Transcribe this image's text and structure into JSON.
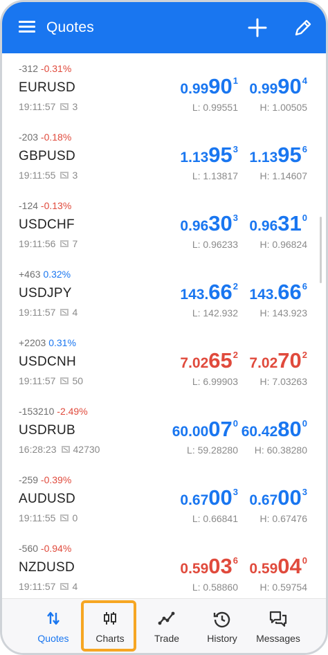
{
  "header": {
    "title": "Quotes",
    "menu_icon": "hamburger-icon",
    "add_icon": "plus-icon",
    "edit_icon": "pencil-icon",
    "color": "#1976f0"
  },
  "quotes": [
    {
      "change_pts": "-312",
      "change_pct": "-0.31%",
      "symbol": "EURUSD",
      "time": "19:11:57",
      "spread": "3",
      "bid": {
        "small": "0.99",
        "big": "90",
        "sup": "1"
      },
      "ask": {
        "small": "0.99",
        "big": "90",
        "sup": "4"
      },
      "low": "L: 0.99551",
      "high": "H: 1.00505"
    },
    {
      "change_pts": "-203",
      "change_pct": "-0.18%",
      "symbol": "GBPUSD",
      "time": "19:11:55",
      "spread": "3",
      "bid": {
        "small": "1.13",
        "big": "95",
        "sup": "3"
      },
      "ask": {
        "small": "1.13",
        "big": "95",
        "sup": "6"
      },
      "low": "L: 1.13817",
      "high": "H: 1.14607"
    },
    {
      "change_pts": "-124",
      "change_pct": "-0.13%",
      "symbol": "USDCHF",
      "time": "19:11:56",
      "spread": "7",
      "bid": {
        "small": "0.96",
        "big": "30",
        "sup": "3"
      },
      "ask": {
        "small": "0.96",
        "big": "31",
        "sup": "0"
      },
      "low": "L: 0.96233",
      "high": "H: 0.96824"
    },
    {
      "change_pts": "+463",
      "change_pct": "0.32%",
      "symbol": "USDJPY",
      "time": "19:11:57",
      "spread": "4",
      "bid": {
        "small": "143.",
        "big": "66",
        "sup": "2"
      },
      "ask": {
        "small": "143.",
        "big": "66",
        "sup": "6"
      },
      "low": "L: 142.932",
      "high": "H: 143.923"
    },
    {
      "change_pts": "+2203",
      "change_pct": "0.31%",
      "symbol": "USDCNH",
      "time": "19:11:57",
      "spread": "50",
      "bid": {
        "small": "7.02",
        "big": "65",
        "sup": "2"
      },
      "ask": {
        "small": "7.02",
        "big": "70",
        "sup": "2"
      },
      "low": "L: 6.99903",
      "high": "H: 7.03263"
    },
    {
      "change_pts": "-153210",
      "change_pct": "-2.49%",
      "symbol": "USDRUB",
      "time": "16:28:23",
      "spread": "42730",
      "bid": {
        "small": "60.00",
        "big": "07",
        "sup": "0"
      },
      "ask": {
        "small": "60.42",
        "big": "80",
        "sup": "0"
      },
      "low": "L: 59.28280",
      "high": "H: 60.38280"
    },
    {
      "change_pts": "-259",
      "change_pct": "-0.39%",
      "symbol": "AUDUSD",
      "time": "19:11:55",
      "spread": "0",
      "bid": {
        "small": "0.67",
        "big": "00",
        "sup": "3"
      },
      "ask": {
        "small": "0.67",
        "big": "00",
        "sup": "3"
      },
      "low": "L: 0.66841",
      "high": "H: 0.67476"
    },
    {
      "change_pts": "-560",
      "change_pct": "-0.94%",
      "symbol": "NZDUSD",
      "time": "19:11:57",
      "spread": "4",
      "bid": {
        "small": "0.59",
        "big": "03",
        "sup": "6"
      },
      "ask": {
        "small": "0.59",
        "big": "04",
        "sup": "0"
      },
      "low": "L: 0.58860",
      "high": "H: 0.59754"
    }
  ],
  "colors": {
    "up": "#1976f0",
    "down": "#e04a3c",
    "highlight": "#f6a623"
  },
  "nav": [
    {
      "label": "Quotes",
      "icon": "arrows-updown-icon",
      "active": true
    },
    {
      "label": "Charts",
      "icon": "candlestick-icon",
      "active": false,
      "highlighted": true
    },
    {
      "label": "Trade",
      "icon": "trend-line-icon",
      "active": false
    },
    {
      "label": "History",
      "icon": "history-clock-icon",
      "active": false
    },
    {
      "label": "Messages",
      "icon": "messages-icon",
      "active": false
    }
  ]
}
